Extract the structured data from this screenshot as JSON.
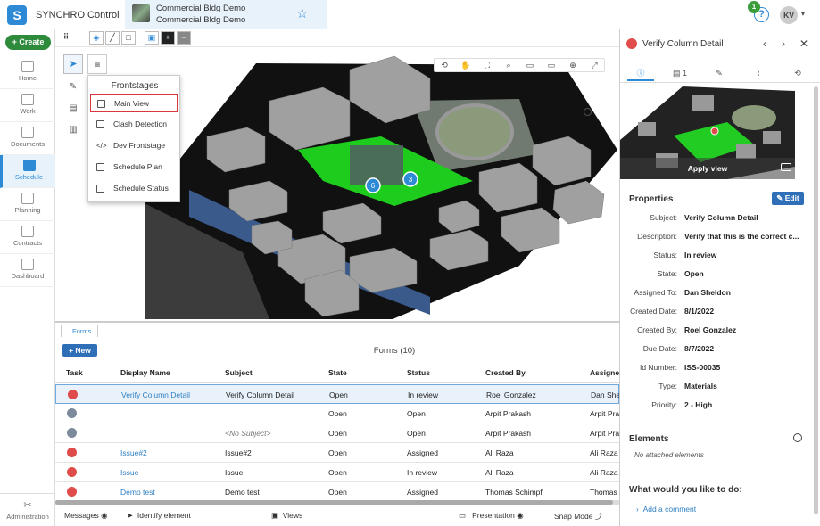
{
  "app": {
    "title": "SYNCHRO Control"
  },
  "project": {
    "line1": "Commercial Bldg Demo",
    "line2": "Commercial Bldg Demo"
  },
  "header": {
    "help": "?",
    "notifications": "1",
    "avatar": "KV"
  },
  "leftnav": {
    "create": "Create",
    "items": [
      {
        "label": "Home",
        "icon": "home-icon"
      },
      {
        "label": "Work",
        "icon": "inbox-icon"
      },
      {
        "label": "Documents",
        "icon": "documents-icon"
      },
      {
        "label": "Schedule",
        "icon": "schedule-icon",
        "active": true
      },
      {
        "label": "Planning",
        "icon": "planning-icon"
      },
      {
        "label": "Contracts",
        "icon": "contracts-icon"
      },
      {
        "label": "Dashboard",
        "icon": "dashboard-icon"
      }
    ],
    "admin": "Administration"
  },
  "frontstages": {
    "title": "Frontstages",
    "items": [
      "Main View",
      "Clash Detection",
      "Dev Frontstage",
      "Schedule Plan",
      "Schedule Status"
    ],
    "selected": "Main View"
  },
  "viewport": {
    "markers": [
      "6",
      "3"
    ]
  },
  "forms": {
    "tab": "Forms",
    "new": "New",
    "title": "Forms (10)",
    "columns": [
      "Task",
      "Display Name",
      "Subject",
      "State",
      "Status",
      "Created By",
      "Assigned"
    ],
    "rows": [
      {
        "task": "red",
        "display": "Verify Column Detail",
        "subject": "Verify Column Detail",
        "state": "Open",
        "status": "In review",
        "created_by": "Roel Gonzalez",
        "assigned": "Dan She",
        "selected": true
      },
      {
        "task": "gray",
        "display": "",
        "subject": "",
        "state": "Open",
        "status": "Open",
        "created_by": "Arpit Prakash",
        "assigned": "Arpit Pra"
      },
      {
        "task": "gray",
        "display": "",
        "subject": "<No Subject>",
        "state": "Open",
        "status": "Open",
        "created_by": "Arpit Prakash",
        "assigned": "Arpit Pra"
      },
      {
        "task": "red",
        "display": "Issue#2",
        "subject": "Issue#2",
        "state": "Open",
        "status": "Assigned",
        "created_by": "Ali Raza",
        "assigned": "Ali Raza"
      },
      {
        "task": "red",
        "display": "Issue",
        "subject": "Issue",
        "state": "Open",
        "status": "In review",
        "created_by": "Ali Raza",
        "assigned": "Ali Raza"
      },
      {
        "task": "red",
        "display": "Demo test",
        "subject": "Demo test",
        "state": "Open",
        "status": "Assigned",
        "created_by": "Thomas Schimpf",
        "assigned": "Thomas"
      }
    ]
  },
  "statusbar": {
    "messages": "Messages",
    "identify": "Identify element",
    "views": "Views",
    "presentation": "Presentation",
    "snap": "Snap Mode"
  },
  "detail": {
    "title": "Verify Column Detail",
    "comments_count": "1",
    "apply_view": "Apply view",
    "properties_title": "Properties",
    "edit": "Edit",
    "properties": [
      {
        "label": "Subject:",
        "value": "Verify Column Detail"
      },
      {
        "label": "Description:",
        "value": "Verify that this is the correct c..."
      },
      {
        "label": "Status:",
        "value": "In review"
      },
      {
        "label": "State:",
        "value": "Open"
      },
      {
        "label": "Assigned To:",
        "value": "Dan Sheldon"
      },
      {
        "label": "Created Date:",
        "value": "8/1/2022"
      },
      {
        "label": "Created By:",
        "value": "Roel Gonzalez"
      },
      {
        "label": "Due Date:",
        "value": "8/7/2022"
      },
      {
        "label": "Id Number:",
        "value": "ISS-00035"
      },
      {
        "label": "Type:",
        "value": "Materials"
      },
      {
        "label": "Priority:",
        "value": "2 - High"
      }
    ],
    "elements_title": "Elements",
    "no_elements": "No attached elements",
    "what_title": "What would you like to do:",
    "add_comment": "Add a comment"
  },
  "colors": {
    "accent": "#2f8ad6",
    "create": "#2e8b3c",
    "issue": "#e04b4b",
    "site_green": "#22dd22"
  }
}
